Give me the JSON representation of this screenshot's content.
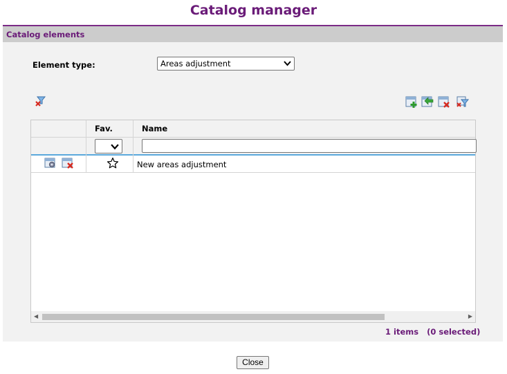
{
  "window": {
    "title": "Catalog manager"
  },
  "panel": {
    "header": "Catalog elements"
  },
  "filter": {
    "element_type_label": "Element type:",
    "element_type_value": "Areas adjustment"
  },
  "toolbar": {
    "clear_filter_icon": "filter-clear-icon",
    "actions": [
      "add-element-icon",
      "import-element-icon",
      "delete-elements-icon",
      "filter-settings-icon"
    ]
  },
  "grid": {
    "columns": [
      "",
      "Fav.",
      "Name"
    ],
    "fav_filter_value": "",
    "name_filter_value": "",
    "rows": [
      {
        "name": "New areas adjustment",
        "favorite": false
      }
    ]
  },
  "footer": {
    "count_text": "1 items   (0 selected)"
  },
  "buttons": {
    "close": "Close"
  },
  "colors": {
    "accent": "#6a1b78",
    "header_bar": "#cccccc",
    "row_separator": "#5aa8dc"
  }
}
